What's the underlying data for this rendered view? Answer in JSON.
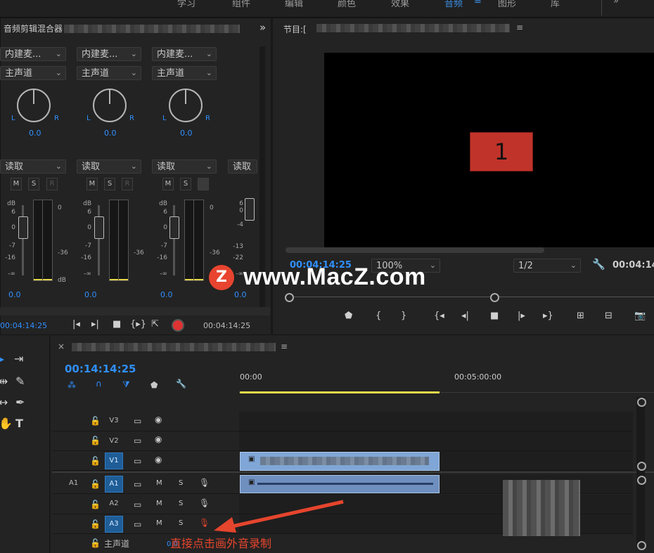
{
  "menu": {
    "items": [
      "学习",
      "组件",
      "编辑",
      "颜色",
      "效果",
      "音频",
      "图形",
      "库"
    ],
    "active": "音频"
  },
  "mixer": {
    "panel_title": "音频剪辑混合器",
    "channels": [
      {
        "input": "内建麦...",
        "output": "主声道",
        "pan_value": "0.0",
        "mode": "读取",
        "fader_value": "0.0"
      },
      {
        "input": "内建麦...",
        "output": "主声道",
        "pan_value": "0.0",
        "mode": "读取",
        "fader_value": "0.0"
      },
      {
        "input": "内建麦...",
        "output": "主声道",
        "pan_value": "0.0",
        "mode": "读取",
        "fader_value": "0.0"
      },
      {
        "input": "",
        "output": "",
        "pan_value": "",
        "mode": "读取",
        "fader_value": "0.0"
      }
    ],
    "knob_left": "L",
    "knob_right": "R",
    "buttons": {
      "mute": "M",
      "solo": "S",
      "record": "R"
    },
    "db_label": "dB",
    "fader_scale": [
      "6",
      "0",
      "-7",
      "-16",
      "-∞"
    ],
    "fader_scale_last": [
      "6",
      "0",
      "-4",
      "-13",
      "-22",
      "-∞"
    ],
    "meter_scale": [
      "0",
      "-36",
      "dB"
    ],
    "meter_floor_level": 0,
    "timecode_left": "00:04:14:25",
    "timecode_right": "00:04:14:25"
  },
  "program": {
    "title": "节目:[",
    "frame_label": "1",
    "timecode": "00:04:14:25",
    "zoom": "100%",
    "resolution": "1/2",
    "duration": "00:04:14"
  },
  "timeline": {
    "timecode": "00:14:14:25",
    "ruler": [
      "00:00",
      "00:05:00:00"
    ],
    "tracks": [
      {
        "name": "V3",
        "type": "video",
        "selected": false
      },
      {
        "name": "V2",
        "type": "video",
        "selected": false
      },
      {
        "name": "V1",
        "type": "video",
        "selected": true
      },
      {
        "name": "A1",
        "type": "audio",
        "selected": true,
        "source": "A1"
      },
      {
        "name": "A2",
        "type": "audio",
        "selected": false
      },
      {
        "name": "A3",
        "type": "audio",
        "selected": true
      }
    ],
    "master_label": "主声道",
    "master_value": "0.0",
    "m_label": "M",
    "s_label": "S"
  },
  "watermark": {
    "logo_letter": "Z",
    "text": "www.MacZ.com"
  },
  "annotation": {
    "text": "直接点击画外音录制",
    "color": "#e5452d"
  },
  "colors": {
    "accent_blue": "#2f8fff",
    "clip": "#7fa6d6",
    "frame_red": "#c0332a",
    "work_area": "#e6d84b"
  }
}
